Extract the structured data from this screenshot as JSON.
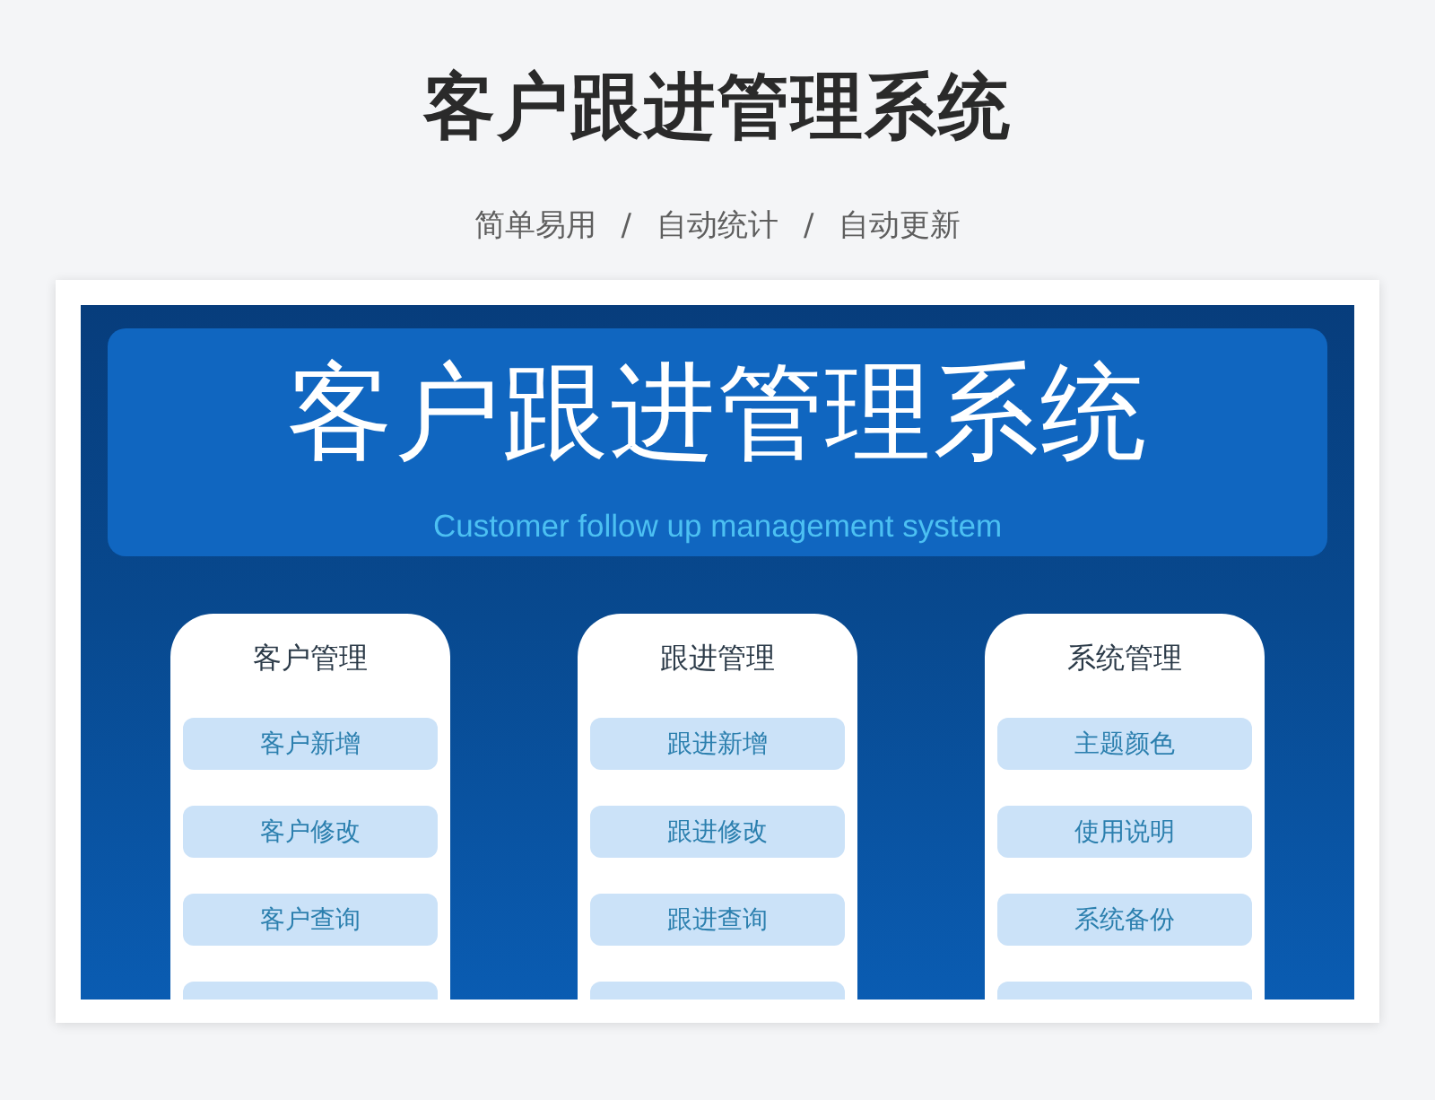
{
  "page": {
    "title": "客户跟进管理系统",
    "taglines": [
      "简单易用",
      "自动统计",
      "自动更新"
    ],
    "separator": "/"
  },
  "app": {
    "title": "客户跟进管理系统",
    "subtitle": "Customer follow up management system",
    "menus": [
      {
        "title": "客户管理",
        "items": [
          "客户新增",
          "客户修改",
          "客户查询"
        ],
        "more_below": true
      },
      {
        "title": "跟进管理",
        "items": [
          "跟进新增",
          "跟进修改",
          "跟进查询"
        ],
        "more_below": true
      },
      {
        "title": "系统管理",
        "items": [
          "主题颜色",
          "使用说明",
          "系统备份"
        ],
        "more_below": true
      }
    ]
  }
}
